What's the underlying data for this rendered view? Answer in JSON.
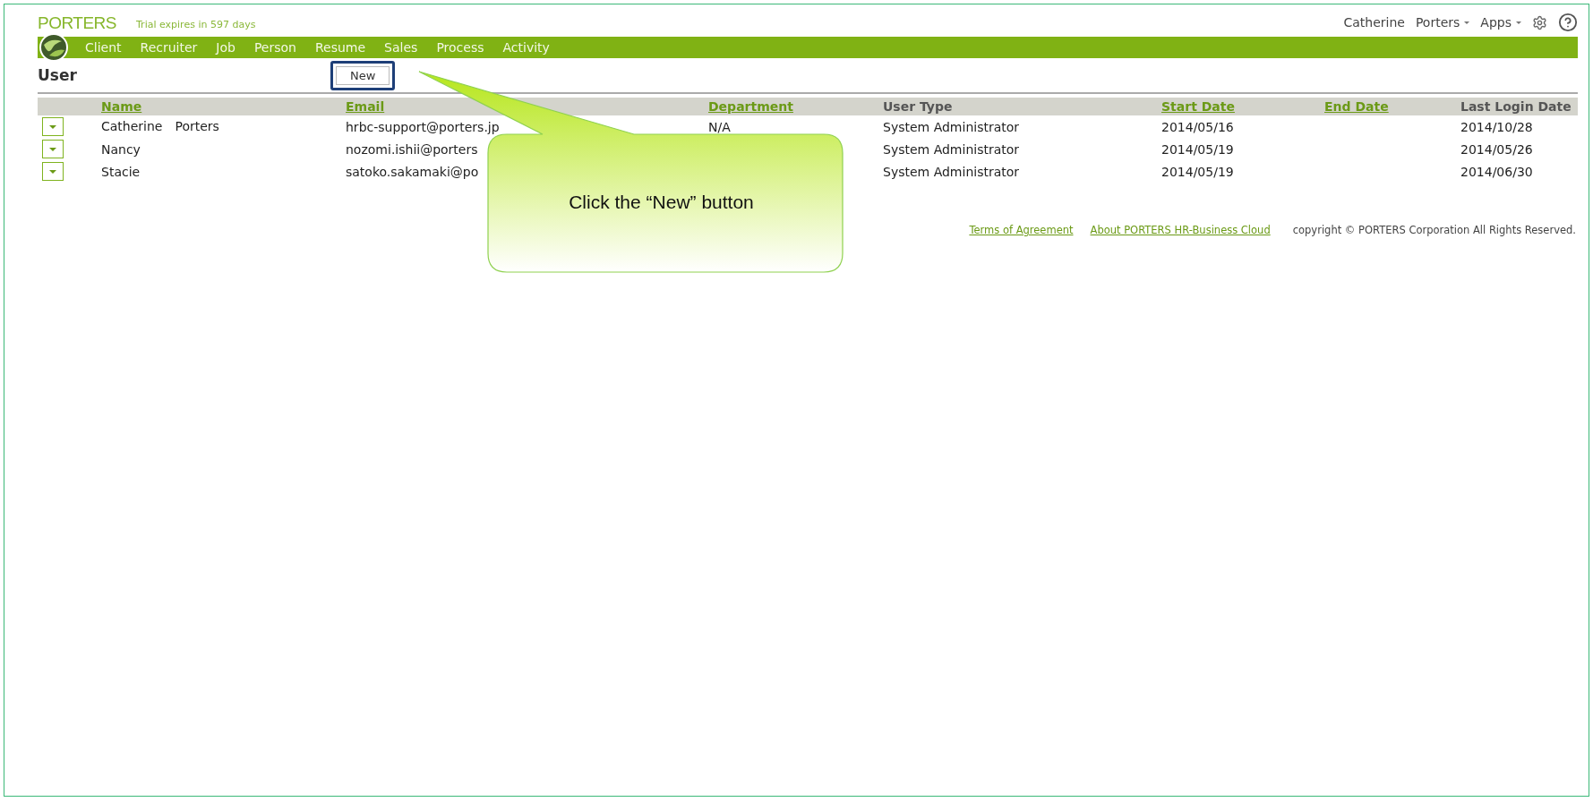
{
  "header": {
    "logo": "PORTERS",
    "trial": "Trial expires in 597 days",
    "user_links": [
      {
        "label": "Catherine",
        "dropdown": false
      },
      {
        "label": "Porters",
        "dropdown": true
      },
      {
        "label": "Apps",
        "dropdown": true
      }
    ]
  },
  "nav": {
    "items": [
      "Client",
      "Recruiter",
      "Job",
      "Person",
      "Resume",
      "Sales",
      "Process",
      "Activity"
    ]
  },
  "page": {
    "title": "User",
    "new_button": "New",
    "highlighted": true
  },
  "table": {
    "columns": [
      {
        "label": "Name",
        "sortable": true
      },
      {
        "label": "Email",
        "sortable": true
      },
      {
        "label": "Department",
        "sortable": true
      },
      {
        "label": "User Type",
        "sortable": false
      },
      {
        "label": "Start Date",
        "sortable": true
      },
      {
        "label": "End Date",
        "sortable": true
      },
      {
        "label": "Last Login Date",
        "sortable": false
      }
    ],
    "rows": [
      {
        "name": "Catherine　Porters",
        "email": "hrbc-support@porters.jp",
        "department": "N/A",
        "user_type": "System Administrator",
        "start_date": "2014/05/16",
        "last_login_date": "2014/10/28"
      },
      {
        "name": "Nancy",
        "email": "nozomi.ishii@porters",
        "user_type": "System Administrator",
        "start_date": "2014/05/19",
        "last_login_date": "2014/05/26"
      },
      {
        "name": "Stacie",
        "email": "satoko.sakamaki@po",
        "user_type": "System Administrator",
        "start_date": "2014/05/19",
        "last_login_date": "2014/06/30"
      }
    ]
  },
  "footer": {
    "links": [
      "Terms of Agreement",
      "About PORTERS HR-Business Cloud"
    ],
    "copyright": "copyright © PORTERS Corporation All Rights Reserved."
  },
  "callout": {
    "text": "Click the “New” button"
  }
}
